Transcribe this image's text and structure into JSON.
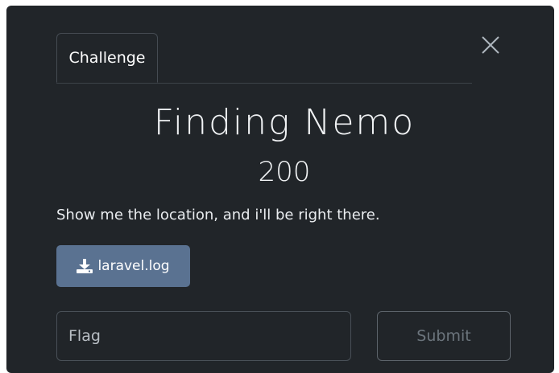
{
  "modal": {
    "close_icon": "close-icon",
    "tabs": [
      {
        "label": "Challenge",
        "active": true
      }
    ],
    "challenge": {
      "name": "Finding Nemo",
      "points": "200",
      "description": "Show me the location, and i'll be right there."
    },
    "file": {
      "icon": "download-icon",
      "label": "laravel.log"
    },
    "flag_input": {
      "placeholder": "Flag",
      "value": ""
    },
    "submit_label": "Submit"
  },
  "colors": {
    "background": "#212529",
    "file_button": "#5a7291",
    "border": "#495057",
    "submit_text": "#6c757d"
  }
}
